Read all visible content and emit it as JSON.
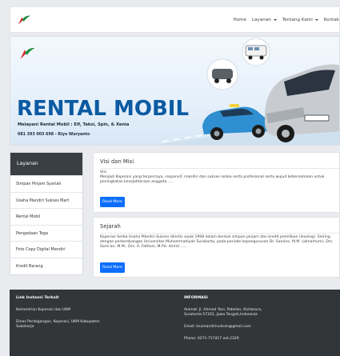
{
  "navbar": {
    "items": [
      {
        "label": "Home",
        "dropdown": false
      },
      {
        "label": "Layanan",
        "dropdown": true
      },
      {
        "label": "Tentang Kami",
        "dropdown": true
      },
      {
        "label": "Kontak",
        "dropdown": false
      }
    ]
  },
  "hero": {
    "title": "RENTAL MOBIL",
    "subtitle": "Melayani Rental Mobil : Elf, Taksi, Spin, & Xenia",
    "contact": "081 393 003 698 - Riyo Wuryanto"
  },
  "sidebar": {
    "title": "Layanan",
    "items": [
      "Simpan Pinjam Syariah",
      "Usaha Mandiri Sukses Mart",
      "Rental Mobil",
      "Pengadaan Toga",
      "Foto Copy Digital Mandiri",
      "Kredit Barang"
    ]
  },
  "cards": [
    {
      "title": "Visi dan Misi",
      "body": "Visi\nMenjadi Koperasi yang terpercaya, responsif, mandiri dan sukses selalu serta profesional serta wujud kebersamaan untuk peningkatan kesejahteraan anggota......",
      "button": "Read More"
    },
    {
      "title": "Sejarah",
      "body": "Koperasi Serba Usaha Mandiri Sukses dirintis sejak 1998 dalam bentuk simpan pinjam dan kredit pemilikan (leasing). Seiring dengan perkembangan Universitas Muhammadiyah Surakarta, pada periode kepengurusan Dr. Samino, M.M. (almarhum), Drs. Sami'an, M.M., Drs. A. Fathoni, M.Pd. dirinti.......",
      "button": "Read More"
    }
  ],
  "footer": {
    "links_title": "Link Instansi Terkait",
    "links": [
      "Kementrian Koperasi dan UKM",
      "Dinas Perdagangan, Koperasi, UKM Kabupaten Sukoharjo"
    ],
    "info_title": "INFORMASI",
    "address": "Alamat: Jl. Ahmad Yani, Pabelan, Kartasura, Surakarta 57162, Jawa Tengah,Indonesia",
    "email": "Email: ksumandirisukses@gmail.com",
    "phone": "Phone: 0271-717417 ext.2329"
  },
  "colors": {
    "primary": "#0d6efd",
    "hero_title": "#0b5aa2",
    "sidebar_head": "#3a3f44",
    "footer": "#323639"
  }
}
